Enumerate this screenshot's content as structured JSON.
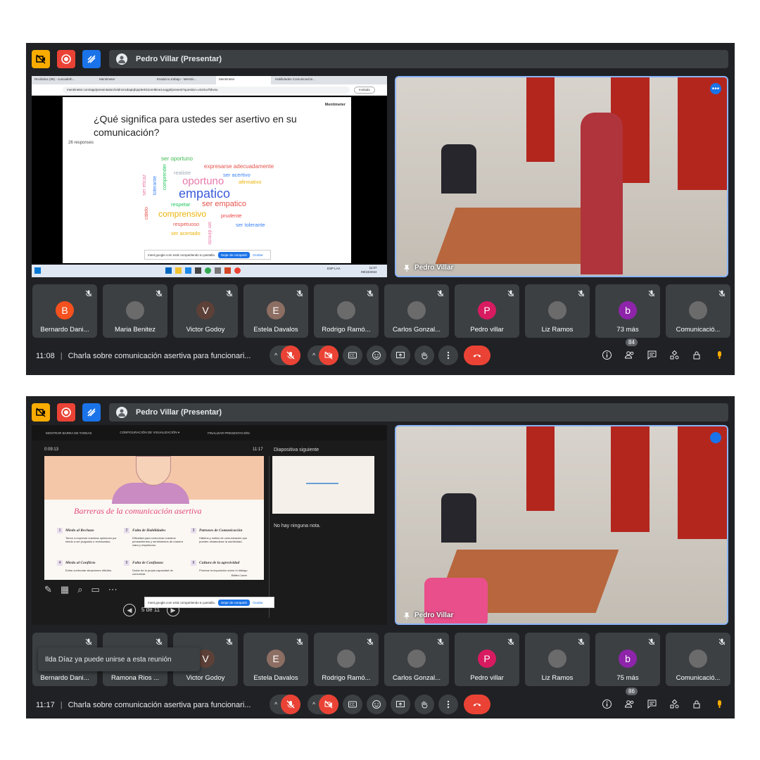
{
  "meeting_title": "Charla sobre comunicación asertiva para funcionari...",
  "presenter_label": "Pedro Villar (Presentar)",
  "colors": {
    "bg": "#202124",
    "tile": "#3c4043",
    "end_call": "#ea4335",
    "accent": "#8ab4f8",
    "mute_red": "#ea4335"
  },
  "screen1": {
    "time": "11:08",
    "people_count": "84",
    "camera_name": "Pedro Villar",
    "browser": {
      "tabs": [
        "Recibidos (99) - cuscadeth...",
        "Mentimeter",
        "Evaluá tu trabajo - Mentim...",
        "Mentimeter",
        "Habilidades Comunicación..."
      ],
      "url": "mentimeter.com/app/presentation/n/alnznsdaqtqfqsp9ekS2om9kne1oxgg0/present?question=vn2mu7bbvsu",
      "bookmark": "Invitado"
    },
    "menti": {
      "brand": "Mentimeter",
      "question": "¿Qué significa para ustedes ser asertivo en su comunicación?",
      "responses": "26 responses",
      "words": [
        "ser oportuno",
        "expresarse adecuadamente",
        "realiste",
        "ser acertivo",
        "oportuno",
        "afirmativo",
        "empatico",
        "ser empatico",
        "respetar",
        "comprensivo",
        "prudente",
        "respetuoso",
        "ser tolerante",
        "ser acertado",
        "ser directo",
        "ser eficaz",
        "tolerante",
        "comprender",
        "cálido"
      ]
    },
    "share_bar": {
      "text": "meet.google.com está compartiendo tu pantalla.",
      "stop": "Dejar de compartir",
      "hide": "Ocultar"
    },
    "taskbar": {
      "lang": "ESP LAA",
      "clock": "11:07",
      "date": "09/10/2024"
    },
    "tiles": [
      {
        "name": "Bernardo Dani...",
        "initial": "B",
        "color": "#f4511e"
      },
      {
        "name": "Maria Benitez",
        "initial": "",
        "color": ""
      },
      {
        "name": "Victor Godoy",
        "initial": "V",
        "color": "#5d4037"
      },
      {
        "name": "Estela Davalos",
        "initial": "E",
        "color": "#8d6e63"
      },
      {
        "name": "Rodrigo Ramó...",
        "initial": "",
        "color": ""
      },
      {
        "name": "Carlos Gonzal...",
        "initial": "",
        "color": ""
      },
      {
        "name": "Pedro villar",
        "initial": "P",
        "color": "#d81b60"
      },
      {
        "name": "Liz Ramos",
        "initial": "",
        "color": ""
      },
      {
        "name": "73 más",
        "initial": "b",
        "color": "#8e24aa"
      },
      {
        "name": "Comunicació...",
        "initial": "",
        "color": ""
      }
    ]
  },
  "screen2": {
    "time": "11:17",
    "people_count": "86",
    "camera_name": "Pedro Villar",
    "presenter_view": {
      "menu": [
        "MOSTRAR BARRA DE TAREAS",
        "CONFIGURACIÓN DE VISUALIZACIÓN ▾",
        "FINALIZAR PRESENTACIÓN"
      ],
      "timer": "0:09:13",
      "clock": "11:17",
      "next_label": "Diapositiva siguiente",
      "notes": "No hay ninguna nota.",
      "slide_counter": "5 de 11"
    },
    "slide": {
      "title": "Barreras de la comunicación asertiva",
      "footer": "Brittles Carner",
      "items": [
        {
          "n": "1",
          "h": "Miedo al Rechazo",
          "t": "Temor a expresar nuestras opiniones por miedo a ser juzgados o rechazados."
        },
        {
          "n": "2",
          "h": "Falta de Habilidades",
          "t": "Dificultad para comunicar nuestros pensamientos y sentimientos de manera clara y respetuosa."
        },
        {
          "n": "3",
          "h": "Patrones de Comunicación",
          "t": "Hábitos y estilos de comunicación que pueden obstaculizar la asertividad."
        },
        {
          "n": "4",
          "h": "Miedo al Conflicto",
          "t": "Evitar confrontar situaciones difíciles."
        },
        {
          "n": "5",
          "h": "Falta de Confianza",
          "t": "Dudar de la propia capacidad de comunicar."
        },
        {
          "n": "6",
          "h": "Cultura de la agresividad",
          "t": "Priorizar la imposición sobre el diálogo."
        }
      ]
    },
    "share_bar": {
      "text": "meet.google.com está compartiendo tu pantalla.",
      "stop": "Dejar de compartir",
      "hide": "Ocultar"
    },
    "toast": "Ilda Díaz ya puede unirse a esta reunión",
    "tiles": [
      {
        "name": "Bernardo Dani...",
        "initial": "",
        "color": ""
      },
      {
        "name": "Ramona Rios ...",
        "initial": "",
        "color": ""
      },
      {
        "name": "Victor Godoy",
        "initial": "V",
        "color": "#5d4037"
      },
      {
        "name": "Estela Davalos",
        "initial": "E",
        "color": "#8d6e63"
      },
      {
        "name": "Rodrigo Ramó...",
        "initial": "",
        "color": ""
      },
      {
        "name": "Carlos Gonzal...",
        "initial": "",
        "color": ""
      },
      {
        "name": "Pedro villar",
        "initial": "P",
        "color": "#d81b60"
      },
      {
        "name": "Liz Ramos",
        "initial": "",
        "color": ""
      },
      {
        "name": "75 más",
        "initial": "b",
        "color": "#8e24aa"
      },
      {
        "name": "Comunicació...",
        "initial": "",
        "color": ""
      }
    ]
  }
}
